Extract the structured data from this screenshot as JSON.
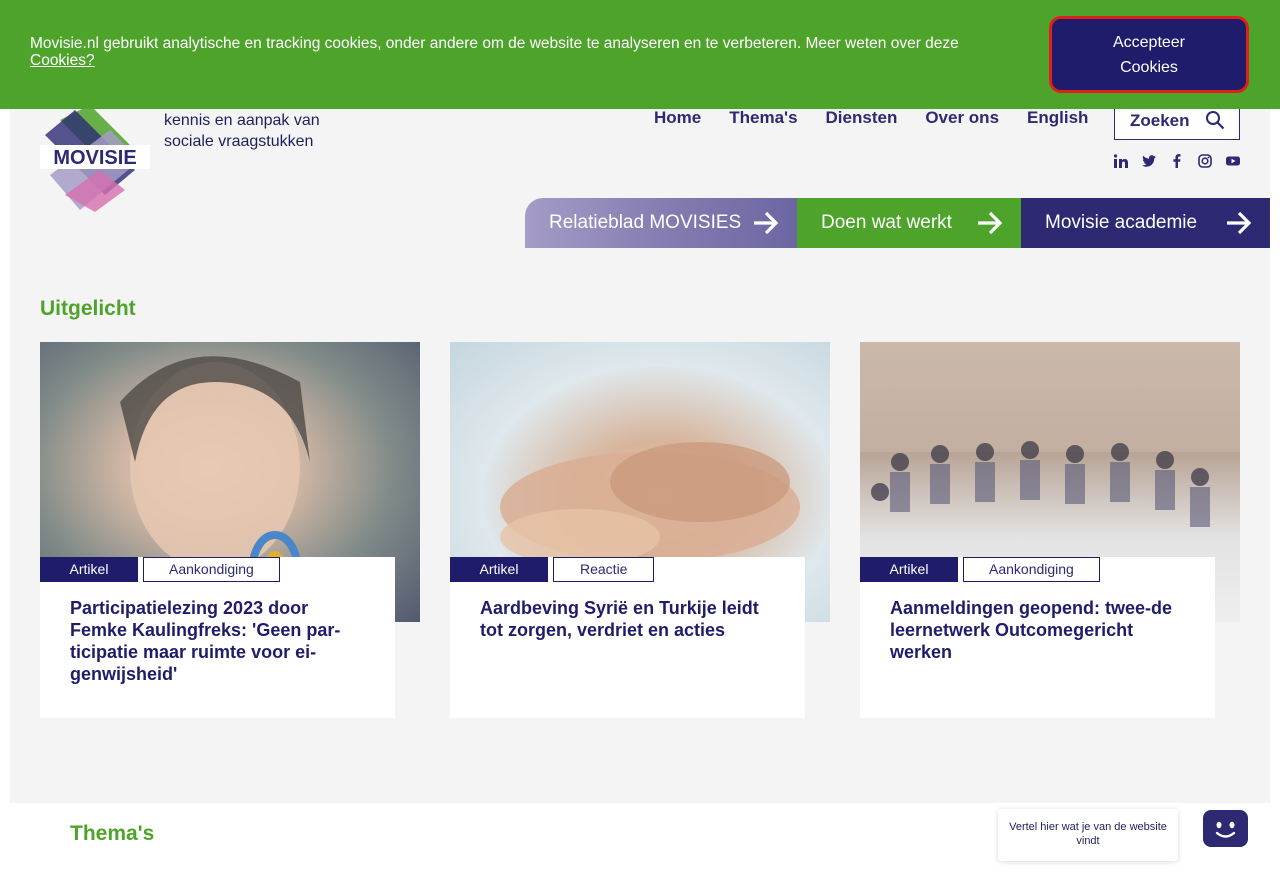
{
  "cookie_bar": {
    "text": "Movisie.nl gebruikt analytische en tracking cookies, onder andere om de website te analyseren en te verbeteren. Meer weten over deze",
    "link": "Cookies?",
    "accept_line1": "Accepteer",
    "accept_line2": "Cookies"
  },
  "header": {
    "logo_text": "MOVISIE",
    "tagline_1": "kennis en aanpak van",
    "tagline_2": "sociale vraagstukken",
    "nav": [
      "Home",
      "Thema's",
      "Diensten",
      "Over ons",
      "English"
    ],
    "search_label": "Zoeken",
    "social_icons": [
      "linkedin-icon",
      "twitter-icon",
      "facebook-icon",
      "instagram-icon",
      "youtube-icon"
    ]
  },
  "promos": [
    {
      "label": "Relatieblad MOVISIES"
    },
    {
      "label": "Doen wat werkt"
    },
    {
      "label": "Movisie academie"
    }
  ],
  "featured": {
    "title": "Uitgelicht",
    "cards": [
      {
        "type": "Artikel",
        "category": "Aankondiging",
        "title": "Participatielezing 2023 door Femke Kaulingfreks: 'Geen par-ticipatie maar ruimte voor ei-genwijsheid'"
      },
      {
        "type": "Artikel",
        "category": "Reactie",
        "title": "Aardbeving Syrië en Turkije leidt tot zorgen, verdriet en acties"
      },
      {
        "type": "Artikel",
        "category": "Aankondiging",
        "title": "Aanmeldingen geopend: twee-de leernetwerk Outcomegericht werken"
      }
    ]
  },
  "themas": {
    "title": "Thema's"
  },
  "chat": {
    "text": "Vertel hier wat je van de website vindt"
  },
  "colors": {
    "green": "#4ea32a",
    "navy": "#1f1d6b",
    "purple": "#2d2a73",
    "alert": "#e0201a"
  }
}
